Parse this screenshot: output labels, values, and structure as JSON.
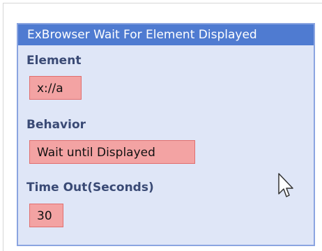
{
  "activity": {
    "title": "ExBrowser Wait For Element Displayed",
    "element_label": "Element",
    "element_value": "x://a",
    "behavior_label": "Behavior",
    "behavior_value": "Wait until Displayed",
    "timeout_label": "Time Out(Seconds)",
    "timeout_value": "30"
  },
  "colors": {
    "title_bar": "#4f7bd1",
    "panel_bg": "#dfe6f7",
    "field_bg": "#f3a3a3",
    "field_border": "#e06f6f",
    "label_text": "#3a4a75"
  },
  "icons": {
    "cursor": "mouse-pointer-icon"
  }
}
